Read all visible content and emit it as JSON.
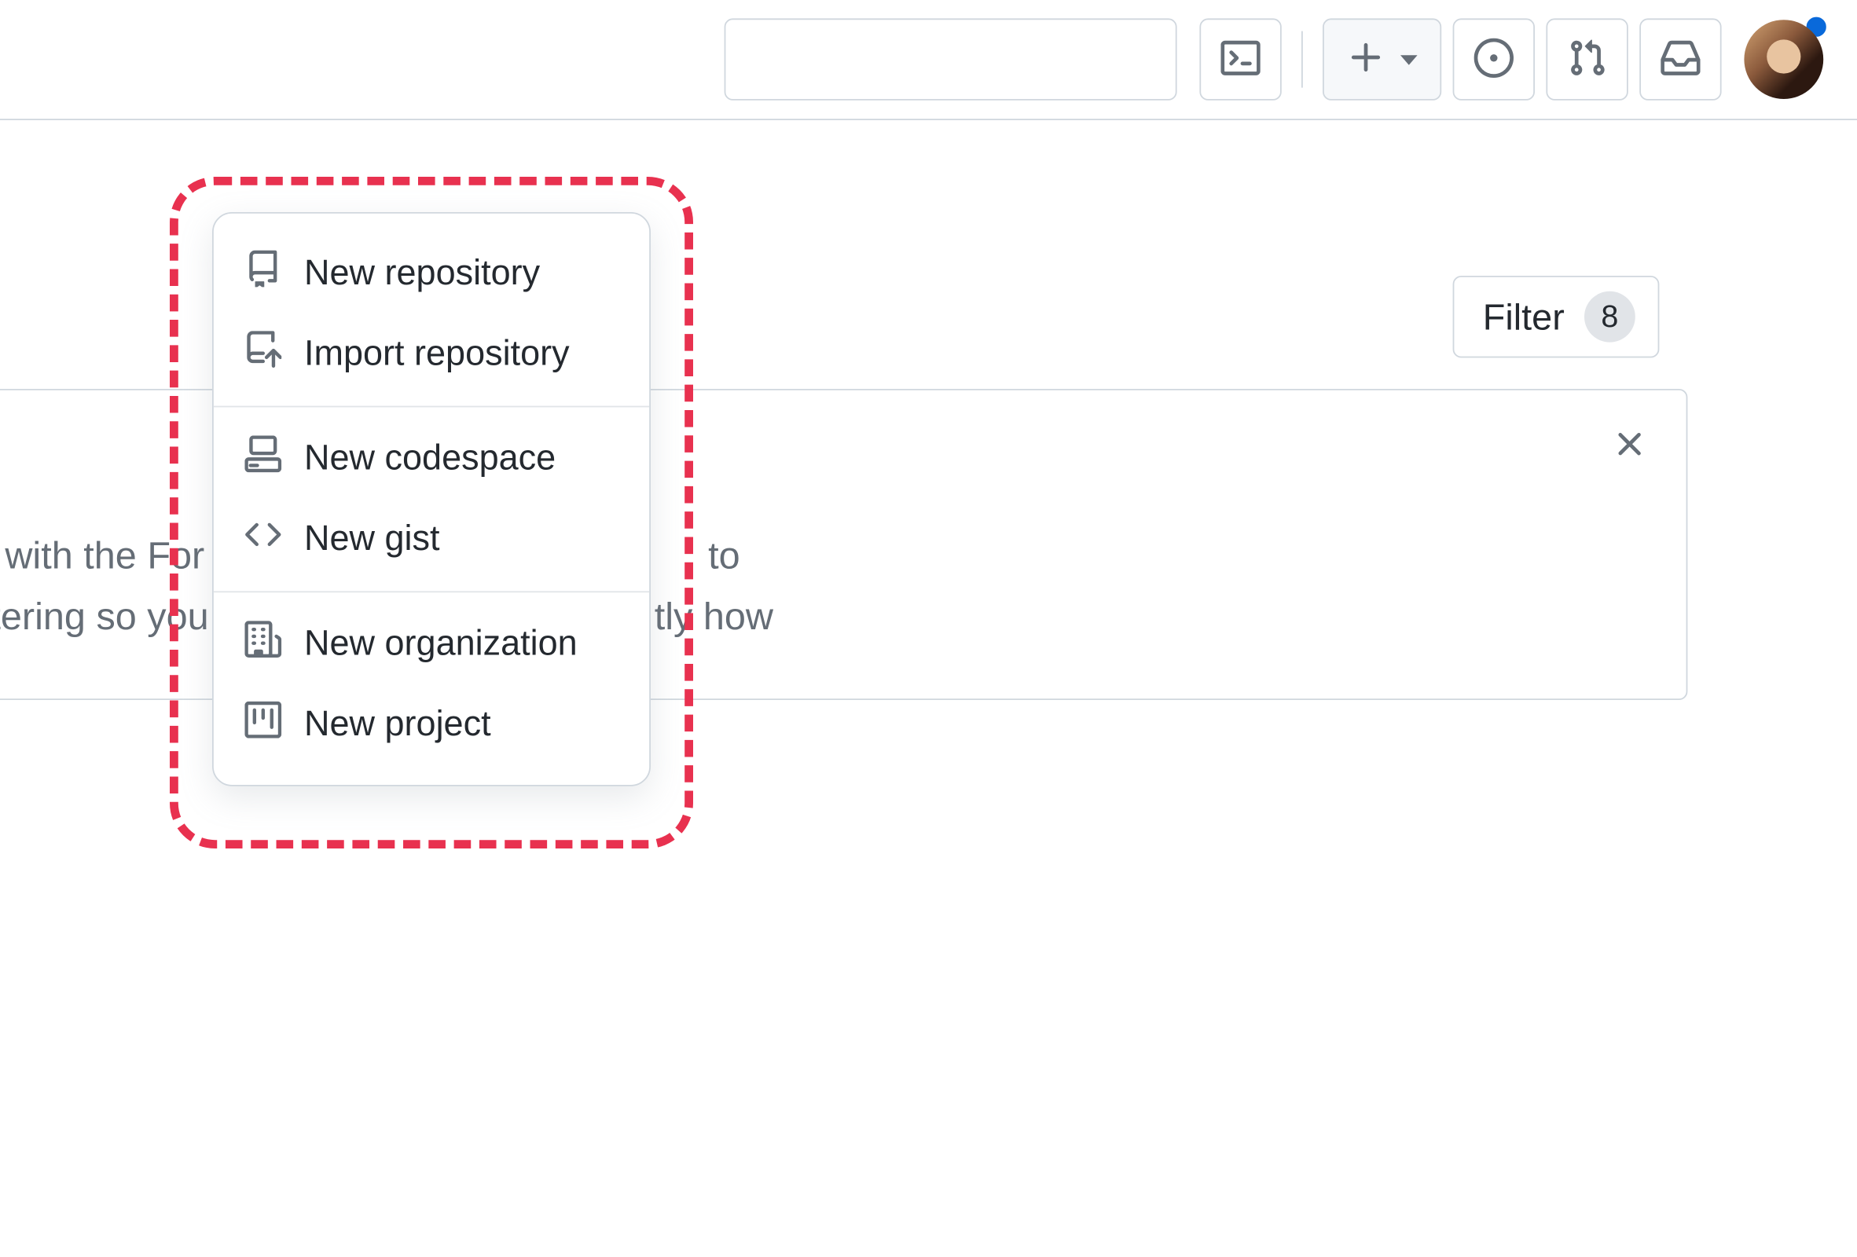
{
  "header": {
    "create_menu": {
      "items": [
        {
          "icon": "repo-icon",
          "label": "New repository"
        },
        {
          "icon": "repo-push-icon",
          "label": "Import repository"
        },
        {
          "icon": "codespaces-icon",
          "label": "New codespace"
        },
        {
          "icon": "code-icon",
          "label": "New gist"
        },
        {
          "icon": "organization-icon",
          "label": "New organization"
        },
        {
          "icon": "project-icon",
          "label": "New project"
        }
      ]
    }
  },
  "filter": {
    "label": "Filter",
    "count": "8"
  },
  "card": {
    "body_line1": "d with the For y",
    "body_line2": "iltering so you",
    "body_tail1": "to",
    "body_tail2": "tly how"
  }
}
